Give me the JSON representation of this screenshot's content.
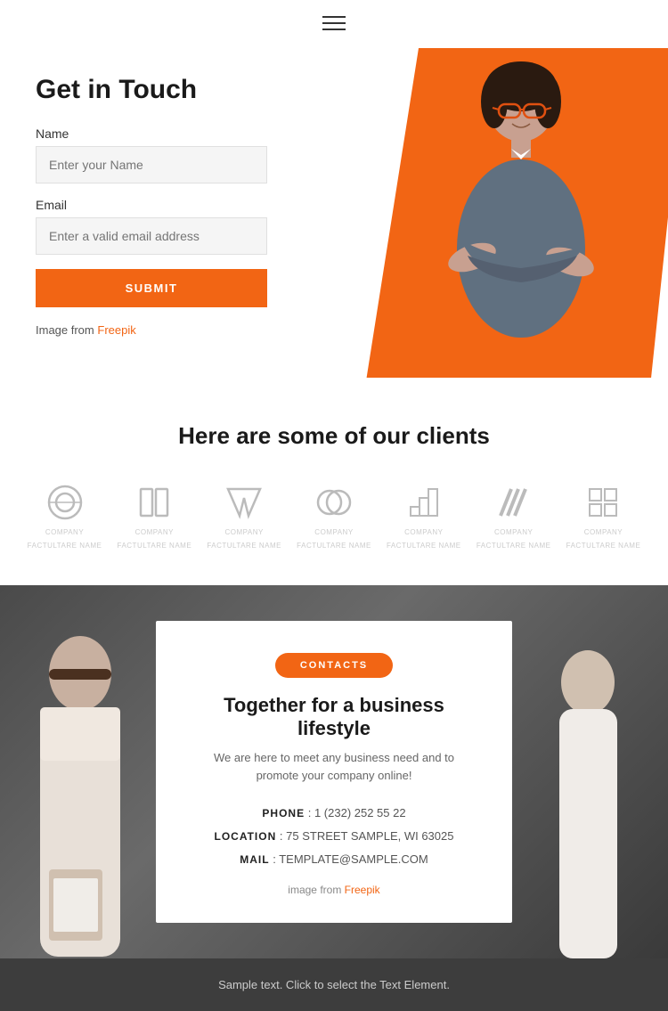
{
  "header": {
    "menu_icon_label": "Menu"
  },
  "hero": {
    "title": "Get in Touch",
    "name_label": "Name",
    "name_placeholder": "Enter your Name",
    "email_label": "Email",
    "email_placeholder": "Enter a valid email address",
    "submit_label": "SUBMIT",
    "image_credit_text": "Image from",
    "image_credit_link": "Freepik"
  },
  "clients": {
    "title": "Here are some of our clients",
    "logos": [
      {
        "id": 1,
        "label": "COMPANY",
        "sub": "FACTULTARE NAME"
      },
      {
        "id": 2,
        "label": "COMPANY",
        "sub": "FACTULTARE NAME"
      },
      {
        "id": 3,
        "label": "COMPANY",
        "sub": "FACTULTARE NAME"
      },
      {
        "id": 4,
        "label": "COMPANY",
        "sub": "FACTULTARE NAME"
      },
      {
        "id": 5,
        "label": "COMPANY",
        "sub": "FACTULTARE NAME"
      },
      {
        "id": 6,
        "label": "COMPANY",
        "sub": "FACTULTARE NAME"
      },
      {
        "id": 7,
        "label": "COMPANY",
        "sub": "FACTULTARE NAME"
      }
    ]
  },
  "contact_section": {
    "badge": "CONTACTS",
    "heading": "Together for a business lifestyle",
    "subtext": "We are here to meet any business need and to promote your company online!",
    "phone_label": "PHONE",
    "phone_value": "1 (232) 252 55 22",
    "location_label": "LOCATION",
    "location_value": "75 STREET SAMPLE, WI 63025",
    "mail_label": "MAIL",
    "mail_value": "TEMPLATE@SAMPLE.COM",
    "image_credit_text": "image from",
    "image_credit_link": "Freepik"
  },
  "footer": {
    "sample_text": "Sample text. Click to select the Text Element."
  }
}
